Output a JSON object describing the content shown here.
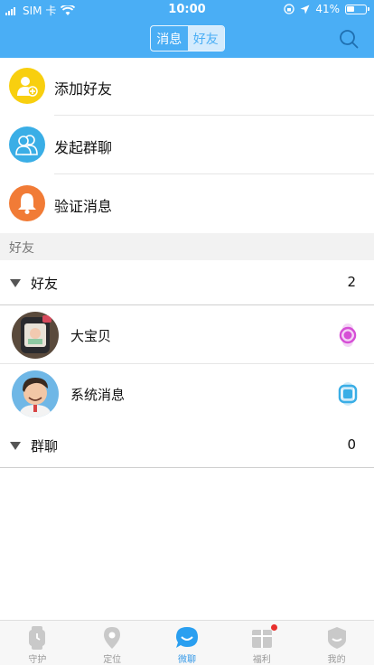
{
  "status_bar": {
    "carrier": "SIM 卡",
    "time": "10:00",
    "battery": "41%"
  },
  "header": {
    "tabs": [
      {
        "label": "消息",
        "active": false
      },
      {
        "label": "好友",
        "active": true
      }
    ],
    "search_icon": "search-icon",
    "color": "#4aaef5"
  },
  "features": [
    {
      "label": "添加好友",
      "icon": "add-friend-icon",
      "color": "#f8cf0f"
    },
    {
      "label": "发起群聊",
      "icon": "group-chat-icon",
      "color": "#3aaee6"
    },
    {
      "label": "验证消息",
      "icon": "bell-icon",
      "color": "#f17b36"
    }
  ],
  "section": {
    "title": "好友"
  },
  "groups": [
    {
      "name": "好友",
      "count": "2"
    },
    {
      "name": "群聊",
      "count": "0"
    }
  ],
  "contacts": [
    {
      "name": "大宝贝",
      "device_color": "#d64fd6"
    },
    {
      "name": "系统消息",
      "device_color": "#3aaee6"
    }
  ],
  "tabbar": {
    "items": [
      {
        "label": "守护",
        "icon": "watch-icon",
        "active": false
      },
      {
        "label": "定位",
        "icon": "location-pin-icon",
        "active": false
      },
      {
        "label": "微聊",
        "icon": "chat-bubble-icon",
        "active": true
      },
      {
        "label": "福利",
        "icon": "gift-bag-icon",
        "active": false,
        "badge": true
      },
      {
        "label": "我的",
        "icon": "profile-shield-icon",
        "active": false
      }
    ]
  }
}
